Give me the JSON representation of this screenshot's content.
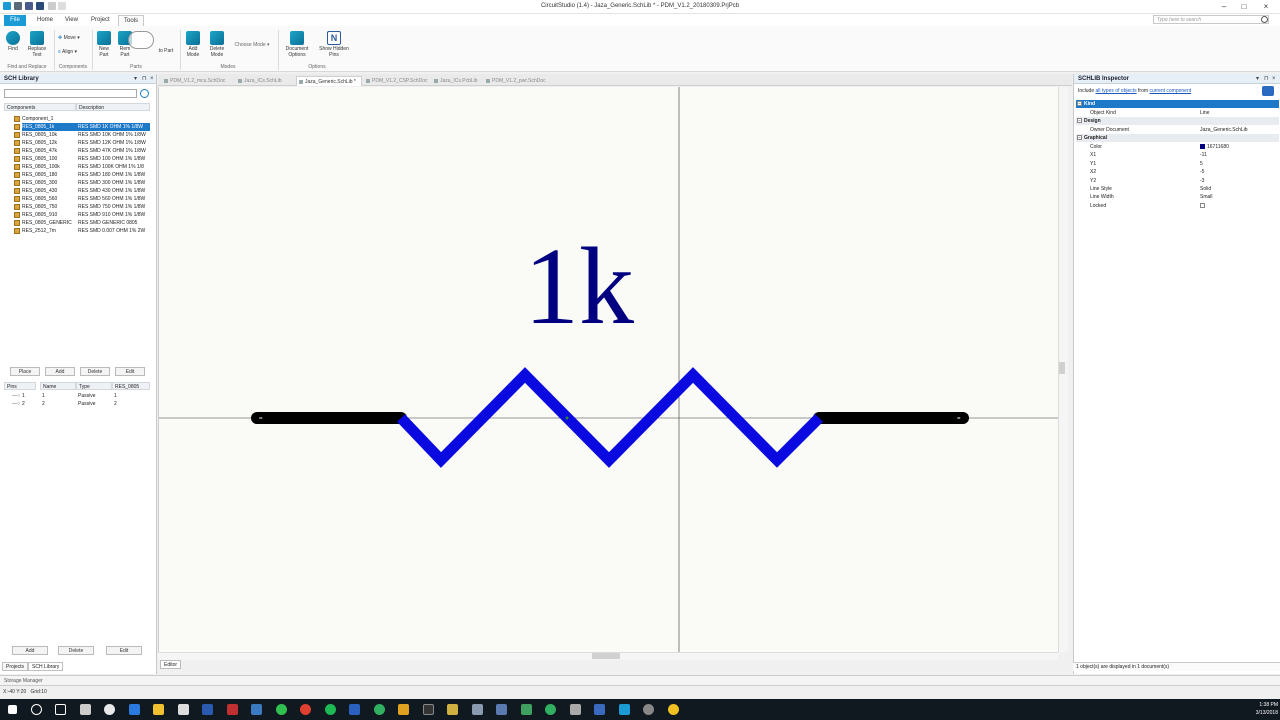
{
  "titlebar": {
    "title": "CircuitStudio (1.4) - Jaza_Generic.SchLib * - PDM_V1.2_20180309.PrjPcb"
  },
  "menu": {
    "file": "File",
    "home": "Home",
    "view": "View",
    "project": "Project",
    "tools": "Tools",
    "search_placeholder": "Type here to search"
  },
  "ribbon": {
    "find": "Find",
    "replace_text": "Replace Text",
    "group_find": "Find and Replace",
    "move": "Move",
    "align": "Align",
    "group_components": "Components",
    "new_part": "New Part",
    "remove_part": "Rem Part",
    "to_part": "to Part",
    "group_parts": "Parts",
    "add_mode": "Add Mode",
    "delete_mode": "Delete Mode",
    "choose_mode": "Choose Mode",
    "group_modes": "Modes",
    "document_options": "Document Options",
    "show_hidden_pins": "Show Hidden Pins",
    "group_options": "Options"
  },
  "sch_library": {
    "title": "SCH Library",
    "col_components": "Components",
    "col_description": "Description",
    "components": [
      {
        "name": "Component_1",
        "desc": ""
      },
      {
        "name": "RES_0805_1k",
        "desc": "RES SMD 1K OHM 1% 1/8W"
      },
      {
        "name": "RES_0805_10k",
        "desc": "RES SMD 10K OHM 1% 1/8W"
      },
      {
        "name": "RES_0805_12k",
        "desc": "RES SMD 12K OHM 1% 1/8W"
      },
      {
        "name": "RES_0805_47k",
        "desc": "RES SMD 47K OHM 1% 1/8W"
      },
      {
        "name": "RES_0805_100",
        "desc": "RES SMD 100 OHM 1% 1/8W"
      },
      {
        "name": "RES_0805_100k",
        "desc": "RES SMD 100K OHM 1% 1/8"
      },
      {
        "name": "RES_0805_180",
        "desc": "RES SMD 180 OHM 1% 1/8W"
      },
      {
        "name": "RES_0805_300",
        "desc": "RES SMD 300 OHM 1% 1/8W"
      },
      {
        "name": "RES_0805_430",
        "desc": "RES SMD 430 OHM 1% 1/8W"
      },
      {
        "name": "RES_0805_560",
        "desc": "RES SMD 560 OHM 1% 1/8W"
      },
      {
        "name": "RES_0805_750",
        "desc": "RES SMD 750 OHM 1% 1/8W"
      },
      {
        "name": "RES_0805_910",
        "desc": "RES SMD 910 OHM 1% 1/8W"
      },
      {
        "name": "RES_0805_GENERIC",
        "desc": "RES SMD GENERIC 0805"
      },
      {
        "name": "RES_2512_7m",
        "desc": "RES SMD 0.007 OHM 1% 2W"
      }
    ],
    "btn_place": "Place",
    "btn_add": "Add",
    "btn_delete": "Delete",
    "btn_edit": "Edit",
    "pins_cols": {
      "pins": "Pins",
      "name": "Name",
      "type": "Type",
      "part": "RES_0805"
    },
    "pins": [
      {
        "pin": "1",
        "name": "1",
        "type": "Passive",
        "part": "1"
      },
      {
        "pin": "2",
        "name": "2",
        "type": "Passive",
        "part": "2"
      }
    ],
    "btn_add2": "Add",
    "btn_delete2": "Delete",
    "btn_edit2": "Edit",
    "tab_projects": "Projects",
    "tab_schlib": "SCH Library"
  },
  "doc_tabs": [
    {
      "label": "PDM_V1.2_mcu.SchDoc",
      "active": false
    },
    {
      "label": "Jaza_ICs.SchLib",
      "active": false
    },
    {
      "label": "Jaza_Generic.SchLib *",
      "active": true
    },
    {
      "label": "PDM_V1.2_CSP.SchDoc",
      "active": false
    },
    {
      "label": "Jaza_ICs.PcbLib",
      "active": false
    },
    {
      "label": "PDM_V1.2_pwr.SchDoc",
      "active": false
    }
  ],
  "canvas": {
    "label": "1k",
    "resistor_color": "#0a0ae0",
    "lead_color": "#000000",
    "label_color": "#000080"
  },
  "editor_tab": "Editor",
  "inspector": {
    "title": "SCHLIB Inspector",
    "include_prefix": "Include",
    "include_link1": "all types of objects",
    "include_mid": "from",
    "include_link2": "current component",
    "sec_kind": "Kind",
    "object_kind_k": "Object Kind",
    "object_kind_v": "Line",
    "sec_design": "Design",
    "owner_k": "Owner Document",
    "owner_v": "Jaza_Generic.SchLib",
    "sec_graphical": "Graphical",
    "rows": [
      {
        "k": "Color",
        "v": "16711680"
      },
      {
        "k": "X1",
        "v": "-11"
      },
      {
        "k": "Y1",
        "v": "5"
      },
      {
        "k": "X2",
        "v": "-5"
      },
      {
        "k": "Y2",
        "v": "-3"
      },
      {
        "k": "Line Style",
        "v": "Solid"
      },
      {
        "k": "Line Width",
        "v": "Small"
      },
      {
        "k": "Locked",
        "v": ""
      }
    ],
    "status": "1 object(s) are displayed in 1 document(s)"
  },
  "storage_manager": "Storage Manager",
  "status_bar": {
    "coords": "X:-40 Y:20",
    "grid": "Grid:10"
  },
  "clock": {
    "time": "1:38 PM",
    "date": "3/13/2018"
  }
}
